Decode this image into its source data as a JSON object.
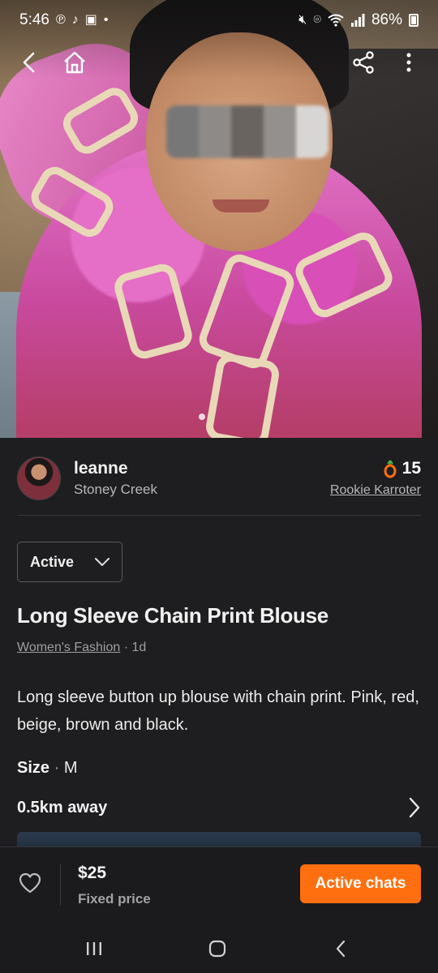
{
  "status_bar": {
    "time": "5:46",
    "battery": "86%"
  },
  "seller": {
    "name": "leanne",
    "location": "Stoney Creek",
    "temperature": "15",
    "level_label": "Rookie Karroter"
  },
  "listing": {
    "status": "Active",
    "title": "Long Sleeve Chain Print Blouse",
    "category": "Women's Fashion",
    "age": " · 1d",
    "description": "Long sleeve button up blouse with chain print. Pink, red, beige, brown and black.",
    "size_label": "Size",
    "size_sep": " · ",
    "size_value": "M",
    "distance": "0.5km away"
  },
  "action_bar": {
    "price": "$25",
    "price_type": "Fixed price",
    "chat_button": "Active chats"
  },
  "colors": {
    "accent": "#ff6f0f",
    "background": "#1e1e20"
  },
  "icons": {
    "back": "chevron-left-icon",
    "home": "home-icon",
    "share": "share-icon",
    "more": "more-vertical-icon",
    "heart": "heart-icon",
    "temperature": "carrot-icon",
    "chevron": "chevron-down-icon",
    "chevron_right": "chevron-right-icon"
  }
}
